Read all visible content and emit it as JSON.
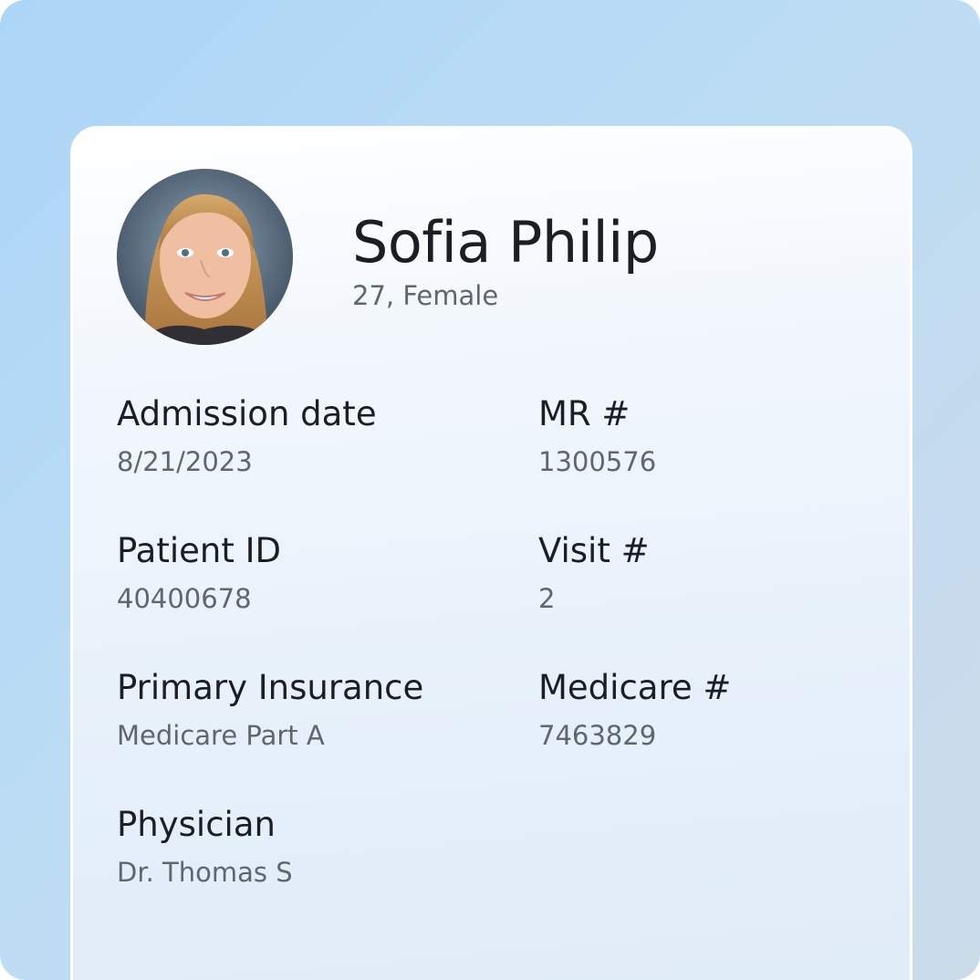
{
  "patient": {
    "name": "Sofia Philip",
    "demographics": "27, Female"
  },
  "fields": [
    {
      "label": "Admission date",
      "value": "8/21/2023"
    },
    {
      "label": "MR #",
      "value": "1300576"
    },
    {
      "label": "Patient ID",
      "value": "40400678"
    },
    {
      "label": "Visit #",
      "value": "2"
    },
    {
      "label": "Primary Insurance",
      "value": "Medicare Part A"
    },
    {
      "label": "Medicare #",
      "value": "7463829"
    },
    {
      "label": "Physician",
      "value": "Dr. Thomas S"
    }
  ],
  "icons": {
    "avatar": "patient-photo-icon"
  },
  "colors": {
    "background_top": "#acd6f7",
    "background_bottom": "#cbdce9",
    "card": "#f2f7fd",
    "label_text": "#1b1e22",
    "value_text": "#5f6670"
  }
}
